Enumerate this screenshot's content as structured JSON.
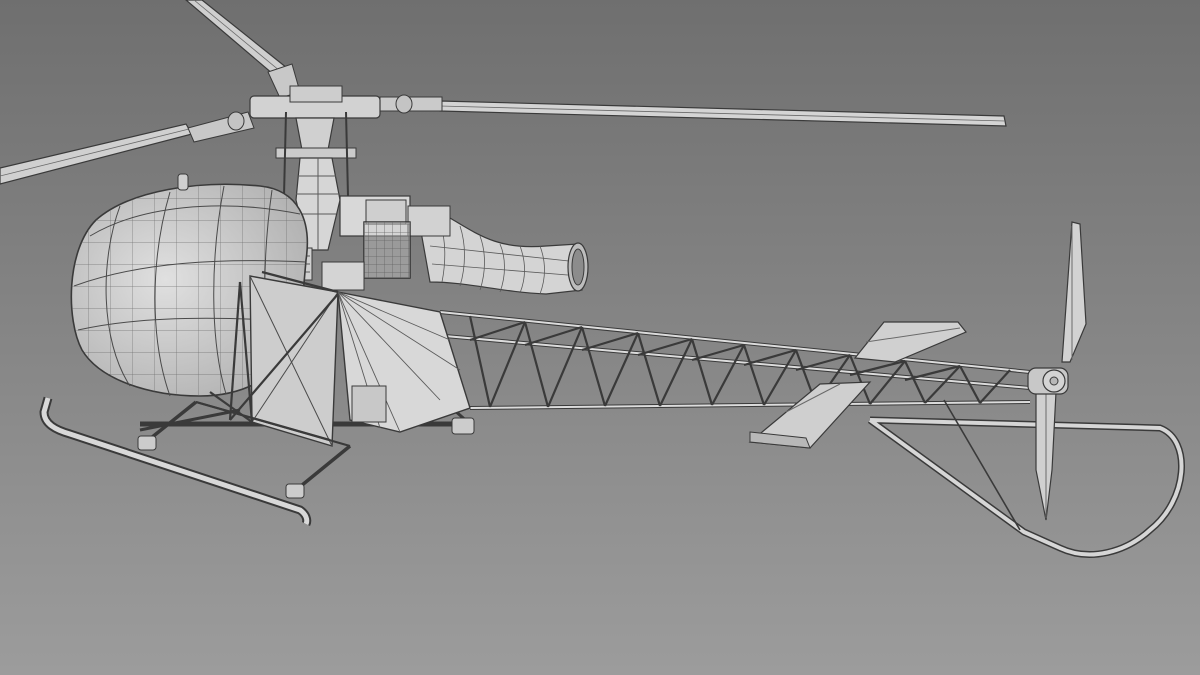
{
  "scene": {
    "subject": "helicopter-wireframe-render",
    "colors": {
      "background_top": "#6f6f6f",
      "background_bottom": "#9c9c9c",
      "surface": "#d2d2d2",
      "surface_light": "#e4e4e4",
      "surface_shade": "#b4b4b4",
      "edge": "#3a3a3a",
      "wire": "#5a5a5a"
    }
  }
}
